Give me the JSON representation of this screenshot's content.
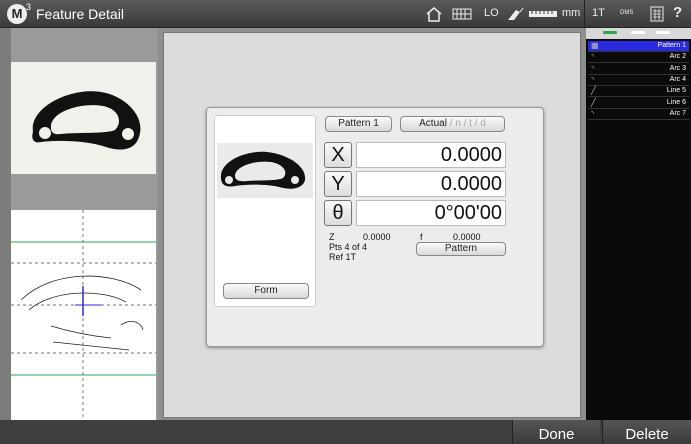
{
  "app": {
    "logo_letter": "M",
    "logo_sup": "3",
    "title": "Feature Detail"
  },
  "topbar": {
    "home_icon": "home-icon",
    "grid_icon": "grid-icon",
    "mode_text": "LO",
    "probe_icon": "probe-icon",
    "ruler_icon": "ruler-icon",
    "units": "mm",
    "right_mode": "1T",
    "dms_label": "DMS",
    "calc_icon": "calculator-icon",
    "help": "?"
  },
  "dialog": {
    "pattern_button": "Pattern 1",
    "actual_button": "Actual",
    "actual_modes": " / n / t / d",
    "axes": [
      {
        "label": "X",
        "value": "0.0000"
      },
      {
        "label": "Y",
        "value": "0.0000"
      },
      {
        "label": "θ",
        "value": "0°00'00"
      }
    ],
    "z_label": "Z",
    "z_value": "0.0000",
    "f_label": "f",
    "f_value": "0.0000",
    "points": "Pts 4 of 4",
    "ref": "Ref 1T",
    "pattern_small_button": "Pattern",
    "form_button": "Form"
  },
  "feature_list": [
    {
      "label": "Pattern 1",
      "icon": "pattern-icon",
      "selected": true
    },
    {
      "label": "Arc 2",
      "icon": "arc-icon",
      "selected": false
    },
    {
      "label": "Arc 3",
      "icon": "arc-icon",
      "selected": false
    },
    {
      "label": "Arc 4",
      "icon": "arc-icon",
      "selected": false
    },
    {
      "label": "Line 5",
      "icon": "line-icon",
      "selected": false
    },
    {
      "label": "Line 6",
      "icon": "line-icon",
      "selected": false
    },
    {
      "label": "Arc 7",
      "icon": "arc-icon",
      "selected": false
    }
  ],
  "bottom": {
    "done": "Done",
    "delete": "Delete"
  },
  "colors": {
    "selected": "#2a2ae0",
    "green_line": "#2aa84a",
    "tab_green": "#2aa84a",
    "tab_white": "#ffffff"
  }
}
